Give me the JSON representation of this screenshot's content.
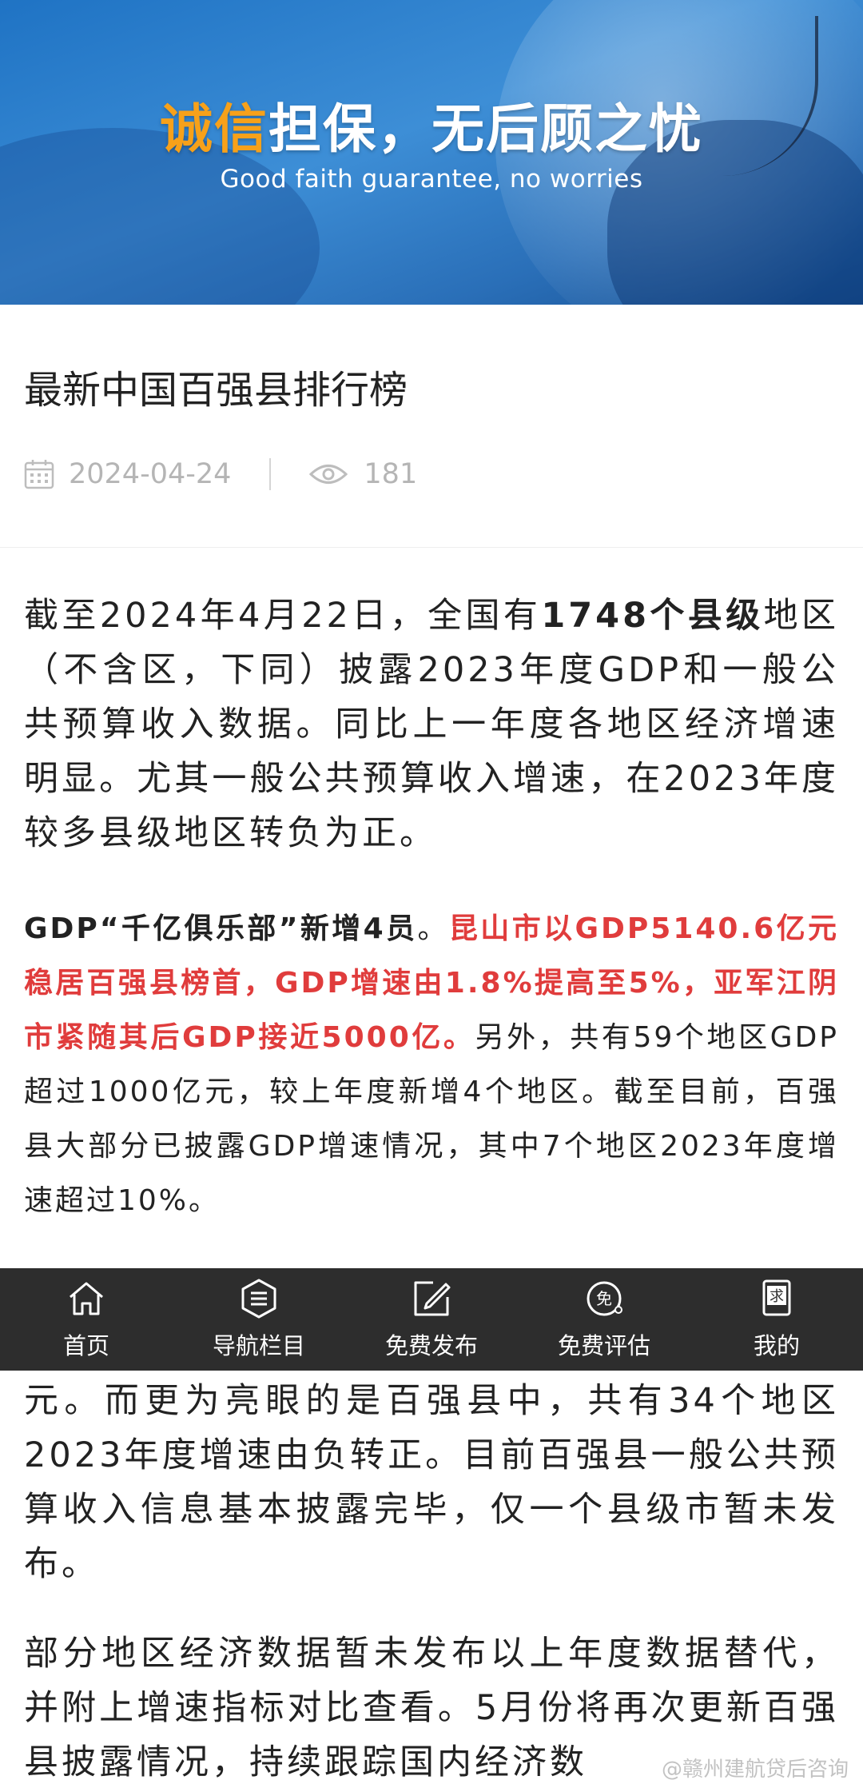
{
  "banner": {
    "title_highlight": "诚信",
    "title_rest": "担保，无后顾之忧",
    "subtitle": "Good faith guarantee, no worries"
  },
  "article": {
    "title": "最新中国百强县排行榜",
    "date": "2024-04-24",
    "views": "181",
    "icons": {
      "date": "calendar-icon",
      "views": "eye-icon"
    }
  },
  "body": {
    "p1": [
      "截至2024年4月22日，全国有",
      "1748个县级",
      "地区（不含区，下同）披露2023年度GDP和一般公共预算收入数据。同比上一年度各地区经济增速明显。尤其一般公共预算收入增速，在2023年度较多县级地区转负为正。"
    ],
    "p2": [
      "GDP“千亿俱乐部”新增4员",
      "。",
      "昆山市以GDP5140.6亿元稳居百强县榜首，GDP增速由1.8%提高至5%，亚军江阴市紧随其后GDP接近5000亿。",
      "另外，共有59个地区GDP超过1000亿元，较上年度新增4个地区。截至目前，百强县大部分已披露GDP增速情况，其中7个地区2023年度增速超过10%。"
    ],
    "p3": "元。而更为亮眼的是百强县中，共有34个地区2023年度增速由负转正。目前百强县一般公共预算收入信息基本披露完毕，仅一个县级市暂未发布。",
    "p4": "部分地区经济数据暂未发布以上年度数据替代，并附上增速指标对比查看。5月份将再次更新百强县披露情况，持续跟踪国内经济数"
  },
  "nav": [
    {
      "label": "首页",
      "icon": "home-icon"
    },
    {
      "label": "导航栏目",
      "icon": "list-icon"
    },
    {
      "label": "免费发布",
      "icon": "edit-icon"
    },
    {
      "label": "免费评估",
      "icon": "free-badge-icon"
    },
    {
      "label": "我的",
      "icon": "profile-icon"
    }
  ],
  "watermark": "@赣州建航贷后咨询",
  "colors": {
    "highlight": "#f7a11a",
    "red_text": "#e03c3c",
    "navbar": "#2d2d2d"
  }
}
